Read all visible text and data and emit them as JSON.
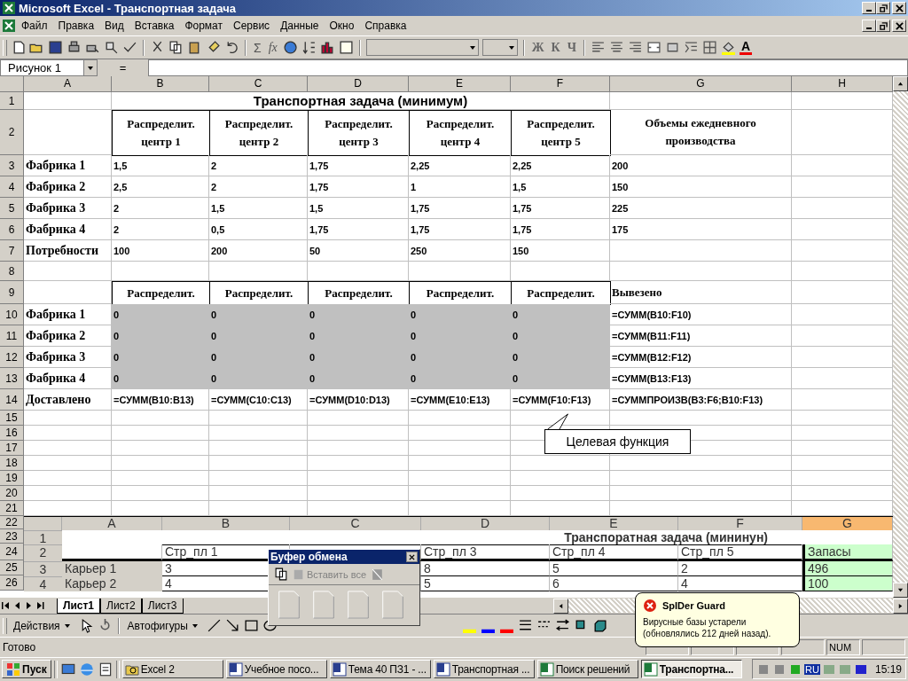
{
  "window": {
    "title": "Microsoft Excel - Транспортная задача"
  },
  "menu": [
    "Файл",
    "Правка",
    "Вид",
    "Вставка",
    "Формат",
    "Сервис",
    "Данные",
    "Окно",
    "Справка"
  ],
  "toolbar": {
    "sum": "Σ",
    "function": "fx",
    "format_buttons": [
      "Ж",
      "К",
      "Ч"
    ],
    "font_color": "A"
  },
  "formula_bar": {
    "name_box": "Рисунок 1",
    "equals": "="
  },
  "sheet": {
    "columns": [
      "A",
      "B",
      "C",
      "D",
      "E",
      "F",
      "G",
      "H"
    ],
    "rows": [
      {
        "number": "1",
        "kind": "title",
        "text": "Транспортная задача (минимум)"
      },
      {
        "number": "2",
        "kind": "header",
        "cells": [
          null,
          "Распределит. центр 1",
          "Распределит. центр 2",
          "Распределит. центр 3",
          "Распределит. центр 4",
          "Распределит. центр 5",
          "Объемы ежедневного производства",
          null
        ]
      },
      {
        "number": "3",
        "kind": "data",
        "cells": [
          "Фабрика 1",
          "1,5",
          "2",
          "1,75",
          "2,25",
          "2,25",
          "200",
          null
        ]
      },
      {
        "number": "4",
        "kind": "data",
        "cells": [
          "Фабрика 2",
          "2,5",
          "2",
          "1,75",
          "1",
          "1,5",
          "150",
          null
        ]
      },
      {
        "number": "5",
        "kind": "data",
        "cells": [
          "Фабрика 3",
          "2",
          "1,5",
          "1,5",
          "1,75",
          "1,75",
          "225",
          null
        ]
      },
      {
        "number": "6",
        "kind": "data",
        "cells": [
          "Фабрика 4",
          "2",
          "0,5",
          "1,75",
          "1,75",
          "1,75",
          "175",
          null
        ]
      },
      {
        "number": "7",
        "kind": "data",
        "cells": [
          "Потребности",
          "100",
          "200",
          "50",
          "250",
          "150",
          null,
          null
        ]
      },
      {
        "number": "8",
        "kind": "blank"
      },
      {
        "number": "9",
        "kind": "header",
        "cells": [
          null,
          "Распределит.",
          "Распределит.",
          "Распределит.",
          "Распределит.",
          "Распределит.",
          "Вывезено",
          null
        ]
      },
      {
        "number": "10",
        "kind": "shaded",
        "cells": [
          "Фабрика 1",
          "0",
          "0",
          "0",
          "0",
          "0",
          "=СУММ(B10:F10)",
          null
        ]
      },
      {
        "number": "11",
        "kind": "shaded",
        "cells": [
          "Фабрика 2",
          "0",
          "0",
          "0",
          "0",
          "0",
          "=СУММ(B11:F11)",
          null
        ]
      },
      {
        "number": "12",
        "kind": "shaded",
        "cells": [
          "Фабрика 3",
          "0",
          "0",
          "0",
          "0",
          "0",
          "=СУММ(B12:F12)",
          null
        ]
      },
      {
        "number": "13",
        "kind": "shaded",
        "cells": [
          "Фабрика 4",
          "0",
          "0",
          "0",
          "0",
          "0",
          "=СУММ(B13:F13)",
          null
        ]
      },
      {
        "number": "14",
        "kind": "data",
        "cells": [
          "Доставлено",
          "=СУММ(B10:B13)",
          "=СУММ(C10:C13)",
          "=СУММ(D10:D13)",
          "=СУММ(E10:E13)",
          "=СУММ(F10:F13)",
          "=СУММПРОИЗВ(B3:F6;B10:F13)",
          null
        ]
      },
      {
        "number": "15",
        "kind": "blank"
      },
      {
        "number": "16",
        "kind": "blank"
      },
      {
        "number": "17",
        "kind": "blank"
      },
      {
        "number": "18",
        "kind": "blank"
      },
      {
        "number": "19",
        "kind": "blank"
      },
      {
        "number": "20",
        "kind": "blank"
      },
      {
        "number": "21",
        "kind": "blank"
      }
    ],
    "covered_rows": [
      "22",
      "23",
      "24",
      "25",
      "26"
    ]
  },
  "callout": "Целевая функция",
  "embedded_sheet": {
    "columns": [
      {
        "label": "A",
        "selected": false
      },
      {
        "label": "B",
        "selected": false
      },
      {
        "label": "C",
        "selected": false
      },
      {
        "label": "D",
        "selected": false
      },
      {
        "label": "E",
        "selected": false
      },
      {
        "label": "F",
        "selected": false
      },
      {
        "label": "G",
        "selected": true
      }
    ],
    "rows": [
      {
        "number": "1",
        "kind": "title",
        "text": "Транспоратная задача (мининун)"
      },
      {
        "number": "2",
        "kind": "header",
        "cells": [
          null,
          "Стр_пл 1",
          null,
          "Стр_пл 3",
          "Стр_пл 4",
          "Стр_пл 5",
          "Запасы"
        ]
      },
      {
        "number": "3",
        "kind": "data",
        "cells": [
          "Карьер 1",
          "3",
          null,
          "8",
          "5",
          "2",
          "496"
        ]
      },
      {
        "number": "4",
        "kind": "data",
        "cells": [
          "Карьер 2",
          "4",
          null,
          "5",
          "6",
          "4",
          "100"
        ]
      }
    ]
  },
  "clipboard": {
    "title": "Буфер обмена",
    "paste_all": "Вставить все"
  },
  "sheet_tabs": [
    {
      "label": "Лист1",
      "selected": true
    },
    {
      "label": "Лист2",
      "selected": false
    },
    {
      "label": "Лист3",
      "selected": false
    }
  ],
  "drawing_toolbar": {
    "actions": "Действия",
    "autoshapes": "Автофигуры"
  },
  "notification": {
    "title": "SpIDer Guard",
    "message": "Вирусные базы устарели (обновлялись 212 дней назад)."
  },
  "status_bar": {
    "status": "Готово",
    "num": "NUM"
  },
  "taskbar": {
    "start": "Пуск",
    "buttons": [
      {
        "label": "Excel 2",
        "kind": "folder",
        "selected": false
      },
      {
        "label": "Учебное посо...",
        "kind": "word",
        "selected": false
      },
      {
        "label": "Тема 40 ПЗ1 - ...",
        "kind": "word",
        "selected": false
      },
      {
        "label": "Транспортная ...",
        "kind": "word",
        "selected": false
      },
      {
        "label": "Поиск решений",
        "kind": "excel",
        "selected": false
      },
      {
        "label": "Транспортна...",
        "kind": "excel",
        "selected": true
      }
    ],
    "language": "RU",
    "clock": "15:19"
  }
}
